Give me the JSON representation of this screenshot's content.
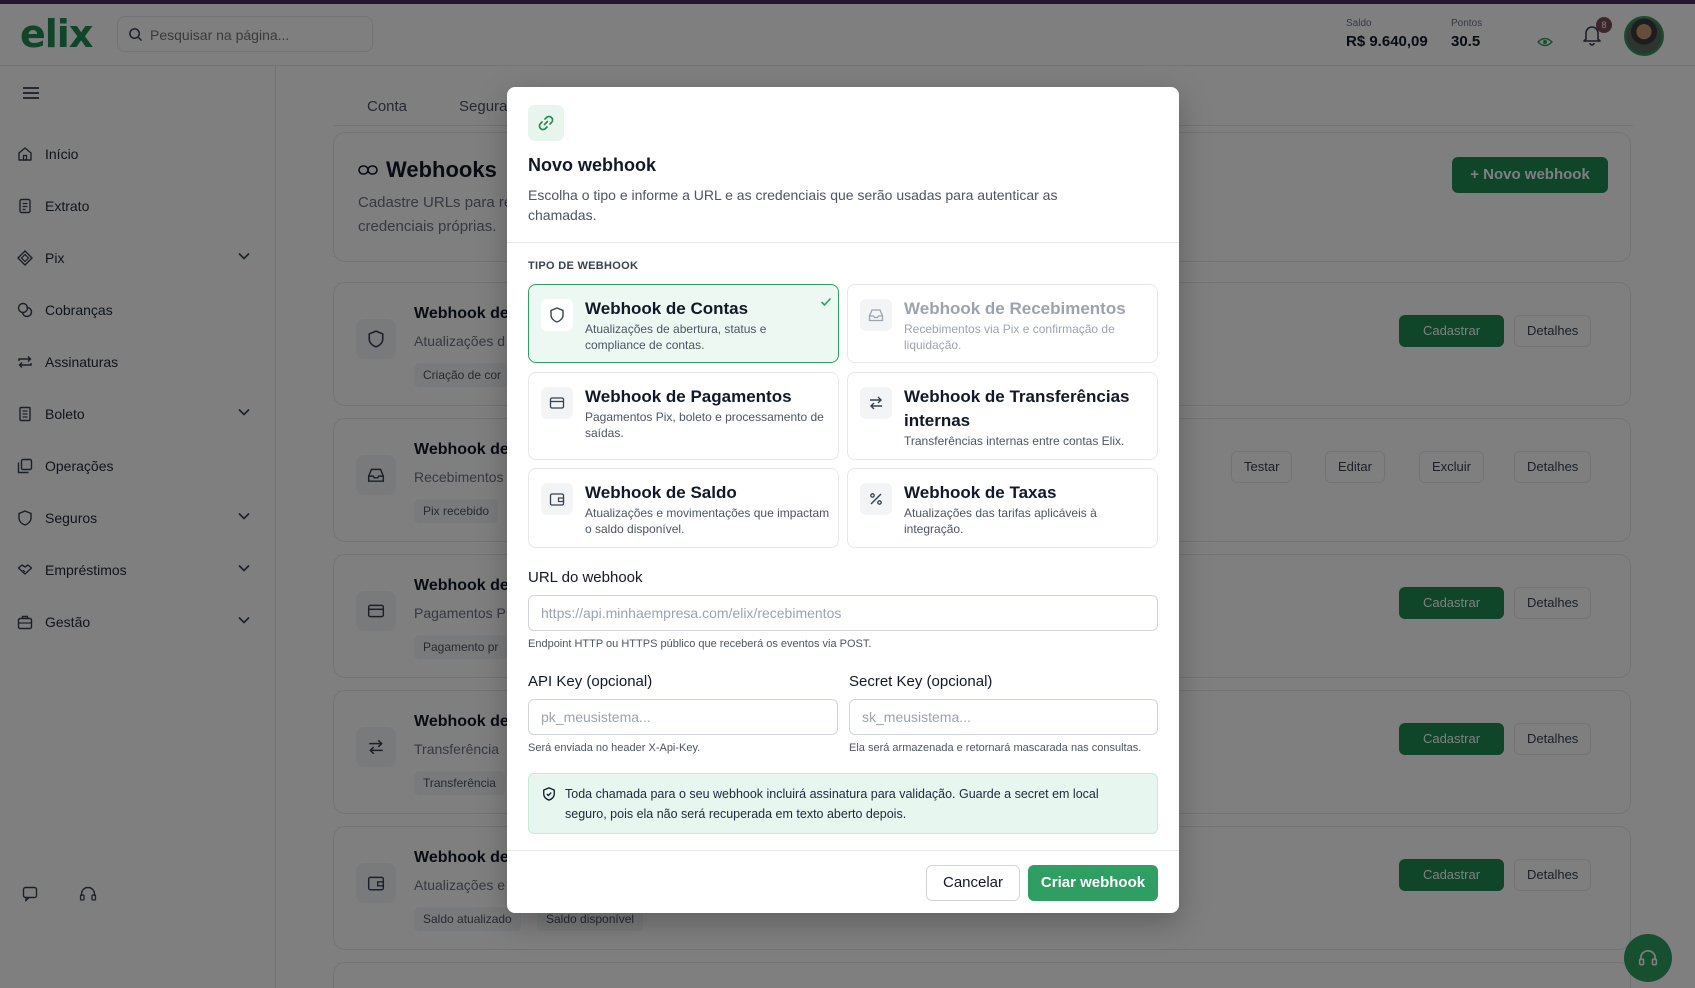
{
  "app": {
    "logo": "elix"
  },
  "header": {
    "search_placeholder": "Pesquisar na página...",
    "balance_label": "Saldo",
    "balance_value": "R$ 9.640,09",
    "points_label": "Pontos",
    "points_value": "30.5",
    "notification_count": "8"
  },
  "sidebar": {
    "items": [
      {
        "label": "Início",
        "icon": "home-icon",
        "expandable": false
      },
      {
        "label": "Extrato",
        "icon": "receipt-icon",
        "expandable": false
      },
      {
        "label": "Pix",
        "icon": "pix-icon",
        "expandable": true
      },
      {
        "label": "Cobranças",
        "icon": "coins-icon",
        "expandable": false
      },
      {
        "label": "Assinaturas",
        "icon": "repeat-icon",
        "expandable": false
      },
      {
        "label": "Boleto",
        "icon": "document-icon",
        "expandable": true
      },
      {
        "label": "Operações",
        "icon": "layers-icon",
        "expandable": false
      },
      {
        "label": "Seguros",
        "icon": "shield-icon",
        "expandable": true
      },
      {
        "label": "Empréstimos",
        "icon": "handshake-icon",
        "expandable": true
      },
      {
        "label": "Gestão",
        "icon": "briefcase-icon",
        "expandable": true
      }
    ]
  },
  "main": {
    "tabs": [
      "Conta",
      "Segura"
    ],
    "section_title": "Webhooks",
    "section_desc": "Cadastre URLs para re credenciais próprias.",
    "new_button": "Novo webhook",
    "rows": [
      {
        "title": "Webhook de",
        "desc": "Atualizações d",
        "tags": [
          "Criação de cor"
        ]
      },
      {
        "title": "Webhook de",
        "desc": "Recebimentos",
        "tags": [
          "Pix recebido"
        ]
      },
      {
        "title": "Webhook de",
        "desc": "Pagamentos P",
        "tags": [
          "Pagamento pr"
        ]
      },
      {
        "title": "Webhook de",
        "desc": "Transferência",
        "tags": [
          "Transferência"
        ]
      },
      {
        "title": "Webhook de",
        "desc": "Atualizações e",
        "tags": [
          "Saldo atualizado",
          "Saldo disponível"
        ]
      }
    ],
    "btn_register": "Cadastrar",
    "btn_details": "Detalhes",
    "btn_test": "Testar",
    "btn_edit": "Editar",
    "btn_delete": "Excluir"
  },
  "modal": {
    "title": "Novo webhook",
    "description": "Escolha o tipo e informe a URL e as credenciais que serão usadas para autenticar as chamadas.",
    "type_label": "TIPO DE WEBHOOK",
    "options": [
      {
        "title": "Webhook de Contas",
        "desc": "Atualizações de abertura, status e compliance de contas.",
        "icon": "shield-icon",
        "state": "selected"
      },
      {
        "title": "Webhook de Recebimentos",
        "desc": "Recebimentos via Pix e confirmação de liquidação.",
        "icon": "inbox-icon",
        "state": "disabled"
      },
      {
        "title": "Webhook de Pagamentos",
        "desc": "Pagamentos Pix, boleto e processamento de saídas.",
        "icon": "credit-card-icon",
        "state": "default"
      },
      {
        "title": "Webhook de Transferências internas",
        "desc": "Transferências internas entre contas Elix.",
        "icon": "arrows-exchange-icon",
        "state": "default"
      },
      {
        "title": "Webhook de Saldo",
        "desc": "Atualizações e movimentações que impactam o saldo disponível.",
        "icon": "wallet-icon",
        "state": "default"
      },
      {
        "title": "Webhook de Taxas",
        "desc": "Atualizações das tarifas aplicáveis à integração.",
        "icon": "percent-icon",
        "state": "default"
      }
    ],
    "url_label": "URL do webhook",
    "url_placeholder": "https://api.minhaempresa.com/elix/recebimentos",
    "url_value": "",
    "url_help": "Endpoint HTTP ou HTTPS público que receberá os eventos via POST.",
    "api_key_label": "API Key (opcional)",
    "api_key_placeholder": "pk_meusistema...",
    "api_key_help": "Será enviada no header X-Api-Key.",
    "secret_key_label": "Secret Key (opcional)",
    "secret_key_placeholder": "sk_meusistema...",
    "secret_key_help": "Ela será armazenada e retornará mascarada nas consultas.",
    "info_text": "Toda chamada para o seu webhook incluirá assinatura para validação. Guarde a secret em local seguro, pois ela não será recuperada em texto aberto depois.",
    "cancel_label": "Cancelar",
    "submit_label": "Criar webhook"
  },
  "colors": {
    "brand": "#2f9e62",
    "brand_dark": "#1f8a52",
    "selected_bg": "#ecf8f1",
    "info_bg": "#e7f6ee"
  }
}
